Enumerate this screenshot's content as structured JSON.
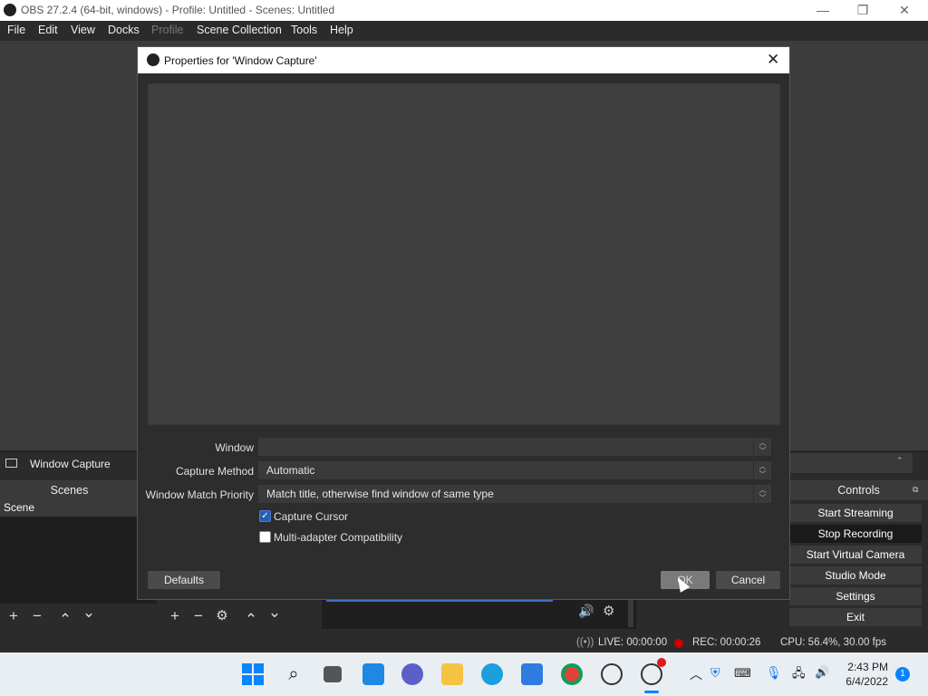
{
  "app": {
    "window_title": "OBS 27.2.4 (64-bit, windows) - Profile: Untitled - Scenes: Untitled",
    "controls": {
      "minimize": "—",
      "maximize": "❐",
      "close": "✕"
    }
  },
  "menubar": [
    {
      "label": "File",
      "enabled": true
    },
    {
      "label": "Edit",
      "enabled": true
    },
    {
      "label": "View",
      "enabled": true
    },
    {
      "label": "Docks",
      "enabled": true
    },
    {
      "label": "Profile",
      "enabled": false
    },
    {
      "label": "Scene Collection",
      "enabled": true
    },
    {
      "label": "Tools",
      "enabled": true
    },
    {
      "label": "Help",
      "enabled": true
    }
  ],
  "source_bar": {
    "label": "Window Capture",
    "icon": "window-icon"
  },
  "scenes": {
    "header": "Scenes",
    "items": [
      "Scene"
    ],
    "toolbar": {
      "add": "+",
      "remove": "−",
      "up": "⌃",
      "down": "⌄"
    }
  },
  "sources": {
    "toolbar": {
      "add": "+",
      "remove": "−",
      "settings": "⚙",
      "up": "⌃",
      "down": "⌄"
    }
  },
  "controls": {
    "header": "Controls",
    "buttons": [
      "Start Streaming",
      "Stop Recording",
      "Start Virtual Camera",
      "Studio Mode",
      "Settings",
      "Exit"
    ]
  },
  "status": {
    "live": "LIVE: 00:00:00",
    "rec": "REC: 00:00:26",
    "cpu": "CPU: 56.4%, 30.00 fps"
  },
  "dialog": {
    "title": "Properties for 'Window Capture'",
    "close": "✕",
    "fields": [
      {
        "label": "Window",
        "value": ""
      },
      {
        "label": "Capture Method",
        "value": "Automatic"
      },
      {
        "label": "Window Match Priority",
        "value": "Match title, otherwise find window of same type"
      }
    ],
    "checkboxes": [
      {
        "label": "Capture Cursor",
        "checked": true
      },
      {
        "label": "Multi-adapter Compatibility",
        "checked": false
      }
    ],
    "buttons": {
      "defaults": "Defaults",
      "ok": "OK",
      "cancel": "Cancel"
    }
  },
  "taskbar": {
    "icons": [
      "windows-start-icon",
      "search-icon",
      "task-view-icon",
      "widgets-icon",
      "teams-chat-icon",
      "file-explorer-icon",
      "edge-icon",
      "store-icon",
      "chrome-icon",
      "obs-icon",
      "obs-recording-icon"
    ],
    "time": "2:43 PM",
    "date": "6/4/2022",
    "notification_count": "1"
  },
  "colors": {
    "accent_blue": "#2a5eb5",
    "rec_red": "#cc0000",
    "panel_dark": "#2b2b2b"
  }
}
